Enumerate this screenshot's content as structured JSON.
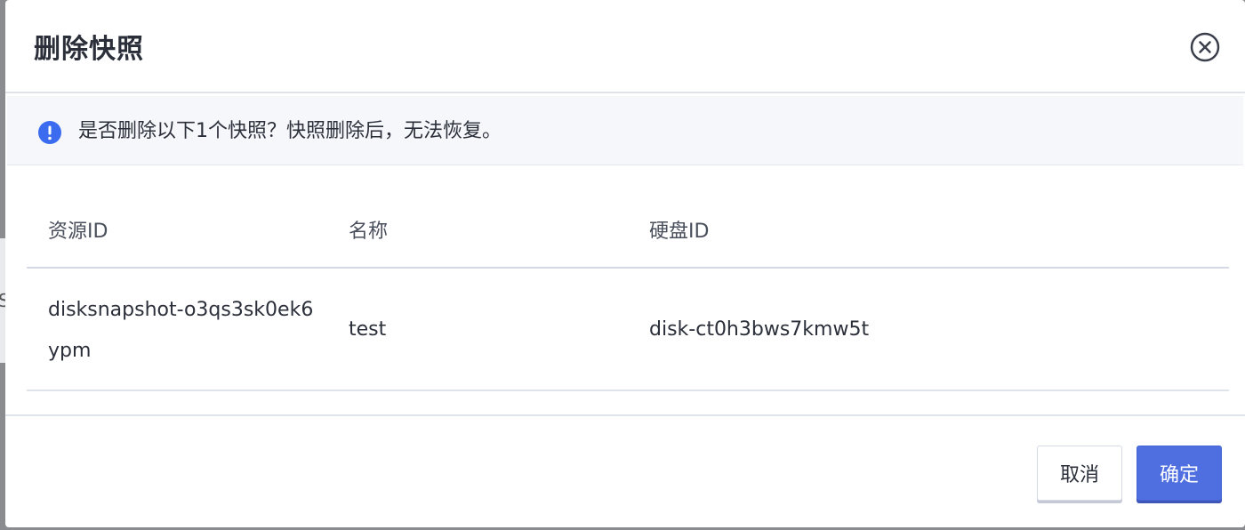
{
  "backdrop": {
    "fragment_text": "S"
  },
  "dialog": {
    "title": "删除快照",
    "close_icon": "close-circle-icon",
    "alert": {
      "icon": "info-exclamation-icon",
      "message": "是否删除以下1个快照？快照删除后，无法恢复。",
      "icon_color": "#3b6cf0"
    },
    "table": {
      "headers": [
        "资源ID",
        "名称",
        "硬盘ID"
      ],
      "rows": [
        {
          "resource_id": "disksnapshot-o3qs3sk0ek6ypm",
          "name": "test",
          "disk_id": "disk-ct0h3bws7kmw5t"
        }
      ]
    },
    "buttons": {
      "cancel": "取消",
      "confirm": "确定"
    },
    "colors": {
      "primary": "#4f6fe0",
      "text": "#2b2f3a"
    }
  }
}
